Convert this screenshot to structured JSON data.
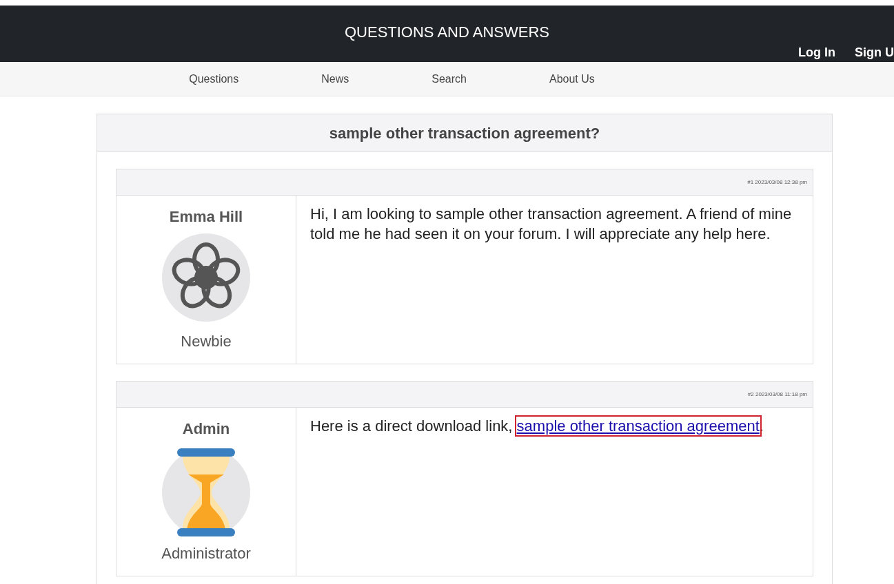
{
  "header": {
    "title": "QUESTIONS AND ANSWERS",
    "links": [
      "Log In",
      "Sign U"
    ]
  },
  "nav": [
    "Questions",
    "News",
    "Search",
    "About Us"
  ],
  "thread": {
    "title": "sample other transaction agreement?",
    "posts": [
      {
        "meta": "#1 2023/03/08 12:38 pm",
        "author": "Emma Hill",
        "avatar": {
          "kind": "flower"
        },
        "rank": "Newbie",
        "text": "Hi, I am looking to sample other transaction agreement. A friend of mine told me he had seen it on your forum. I will appreciate any help here."
      },
      {
        "meta": "#2 2023/03/08 11:18 pm",
        "author": "Admin",
        "avatar": {
          "kind": "hourglass"
        },
        "rank": "Administrator",
        "text": "Here is a direct download link, ",
        "link": {
          "text": "sample other transaction agreement",
          "highlighted": true
        },
        "after": "."
      }
    ]
  }
}
